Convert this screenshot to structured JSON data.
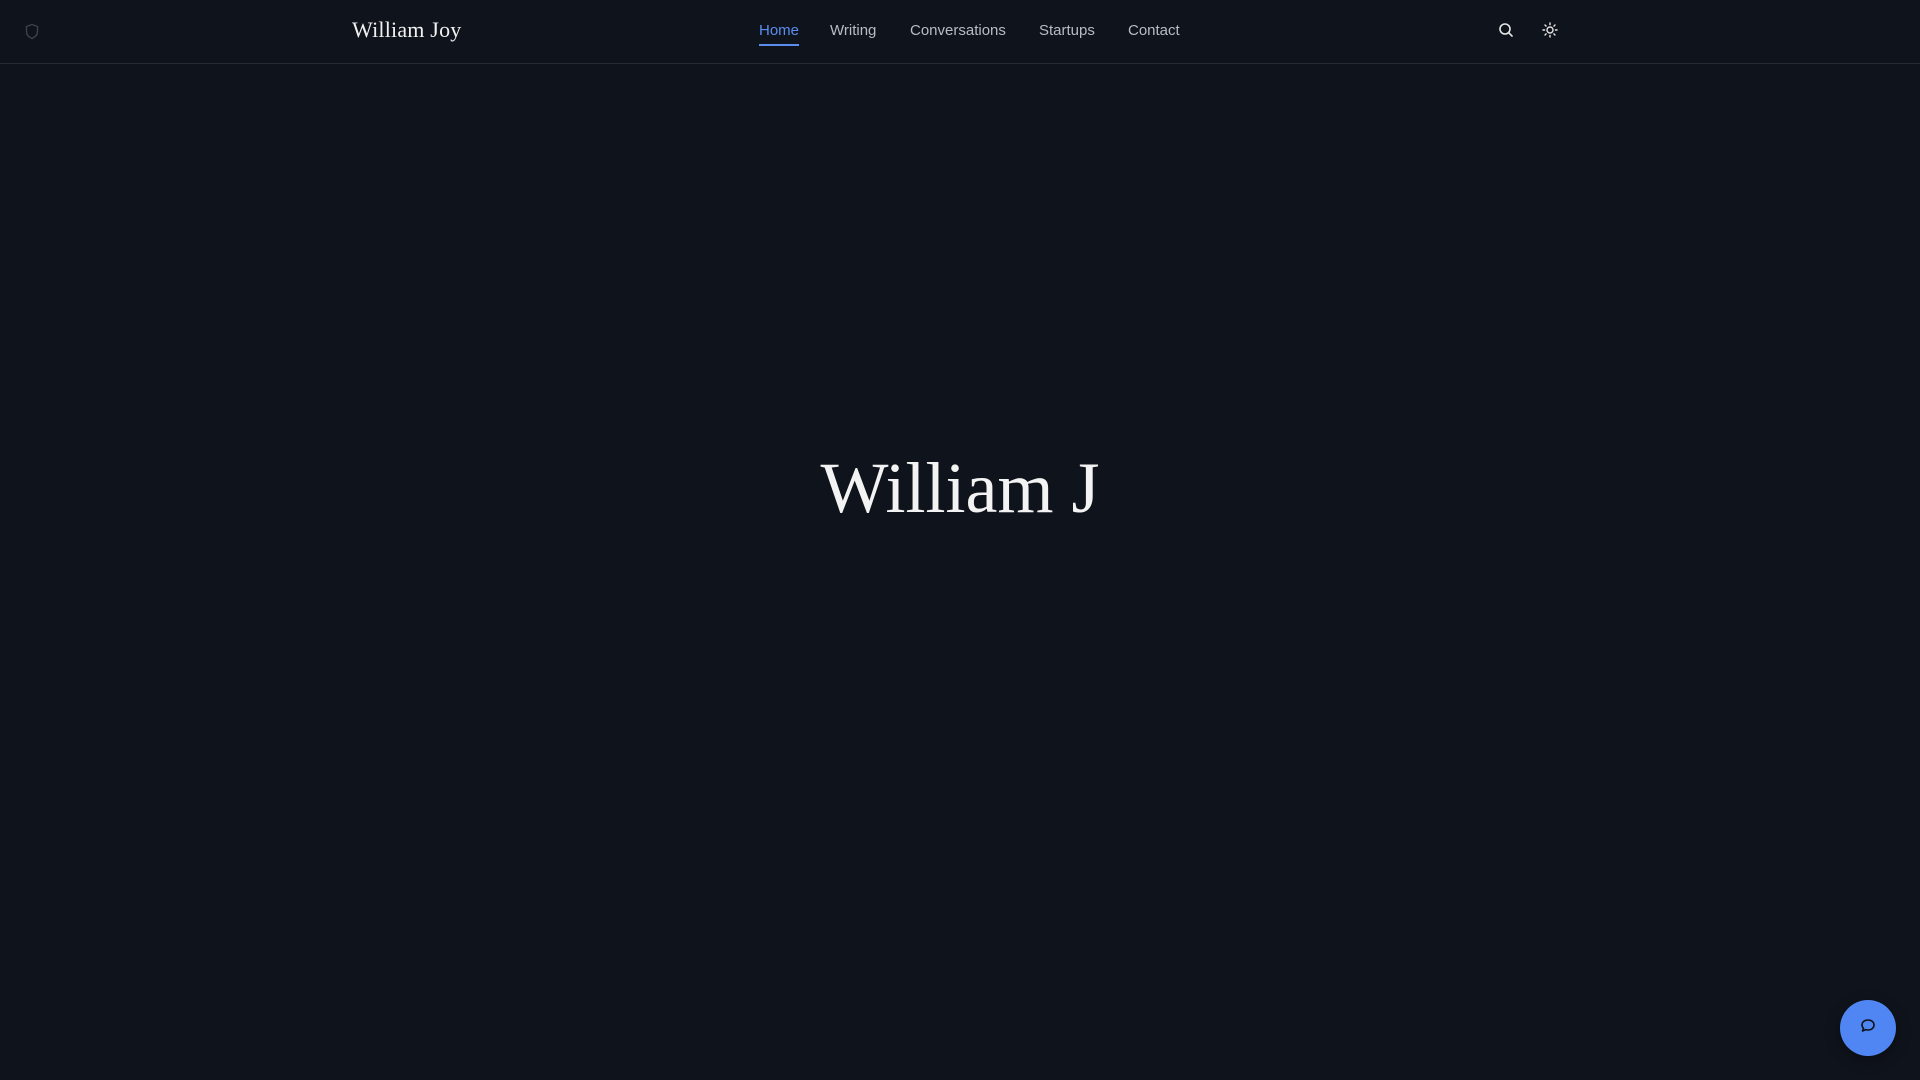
{
  "header": {
    "brand": "William Joy",
    "nav": [
      {
        "label": "Home",
        "active": true
      },
      {
        "label": "Writing",
        "active": false
      },
      {
        "label": "Conversations",
        "active": false
      },
      {
        "label": "Startups",
        "active": false
      },
      {
        "label": "Contact",
        "active": false
      }
    ],
    "icons": {
      "left": "shield-icon",
      "search": "search-icon",
      "theme": "sun-icon"
    }
  },
  "hero": {
    "title": "William J"
  },
  "chat": {
    "icon": "chat-bubble-icon"
  },
  "colors": {
    "background": "#0f131b",
    "accent": "#5b8def",
    "fab": "#4f86f3",
    "text": "#f3f3f3",
    "nav_text": "#b7bcc5"
  }
}
